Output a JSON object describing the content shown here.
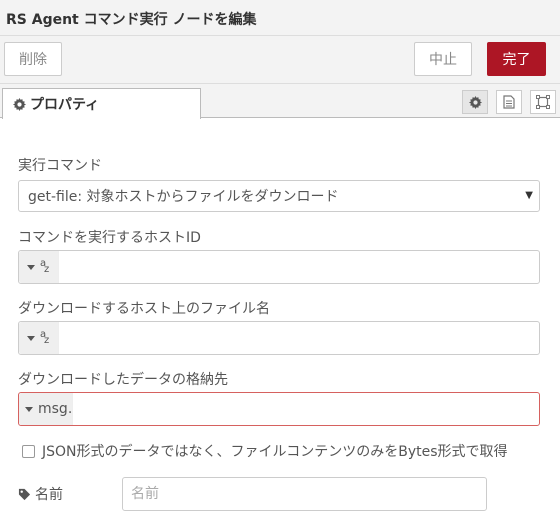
{
  "dialog": {
    "title": "RS Agent コマンド実行 ノードを編集",
    "delete_label": "削除",
    "cancel_label": "中止",
    "done_label": "完了"
  },
  "tabs": {
    "properties_label": "プロパティ"
  },
  "form": {
    "command_label": "実行コマンド",
    "command_value": "get-file: 対象ホストからファイルをダウンロード",
    "host_id_label": "コマンドを実行するホストID",
    "host_id_value": "",
    "filename_label": "ダウンロードするホスト上のファイル名",
    "filename_value": "",
    "store_label": "ダウンロードしたデータの格納先",
    "store_prefix": "msg.",
    "store_value": "",
    "bytes_checkbox_label": "JSON形式のデータではなく、ファイルコンテンツのみをBytes形式で取得",
    "bytes_checked": false,
    "name_label": "名前",
    "name_placeholder": "名前"
  },
  "colors": {
    "accent": "#ad1625",
    "error_border": "#d6615f"
  }
}
